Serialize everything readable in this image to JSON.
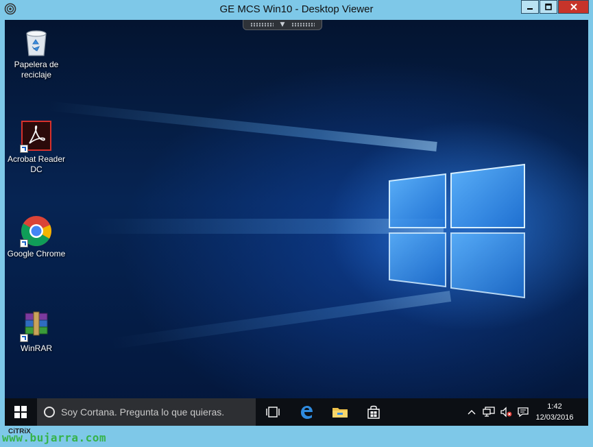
{
  "window": {
    "title": "GE MCS Win10 - Desktop Viewer",
    "icon": "citrix-receiver-icon",
    "buttons": [
      "minimize",
      "maximize",
      "close"
    ],
    "colors": {
      "frame": "#7ec8e8",
      "close": "#c7342a"
    }
  },
  "desktop": {
    "icons": [
      {
        "label": "Papelera de reciclaje",
        "icon": "recycle-bin-icon"
      },
      {
        "label": "Acrobat Reader DC",
        "icon": "acrobat-reader-icon"
      },
      {
        "label": "Google Chrome",
        "icon": "chrome-icon"
      },
      {
        "label": "WinRAR",
        "icon": "winrar-icon"
      }
    ]
  },
  "taskbar": {
    "search_placeholder": "Soy Cortana. Pregunta lo que quieras.",
    "apps": [
      "task-view-icon",
      "edge-icon",
      "file-explorer-icon",
      "store-icon"
    ],
    "tray": [
      "chevron-up-icon",
      "network-icon",
      "volume-muted-icon",
      "notifications-icon"
    ],
    "clock_time": "1:42",
    "clock_date": "12/03/2016"
  },
  "footer": {
    "citrix_label": "CiTRiX",
    "watermark": "www.bujarra.com"
  }
}
